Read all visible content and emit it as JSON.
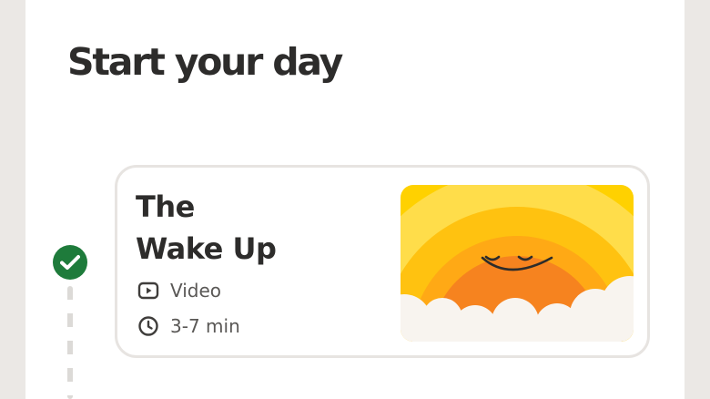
{
  "section": {
    "title": "Start your day"
  },
  "session": {
    "title_line1": "The",
    "title_line2": "Wake Up",
    "type_label": "Video",
    "duration_label": "3-7 min",
    "completed": true
  },
  "icons": {
    "status": "checkmark-icon",
    "type": "play-video-icon",
    "duration": "clock-icon"
  },
  "colors": {
    "accent_green": "#1e7b3b",
    "sun_orange": "#f6831f",
    "sky_yellow": "#ffd100",
    "title_text": "#2d2c2b",
    "meta_text": "#5a5856"
  }
}
